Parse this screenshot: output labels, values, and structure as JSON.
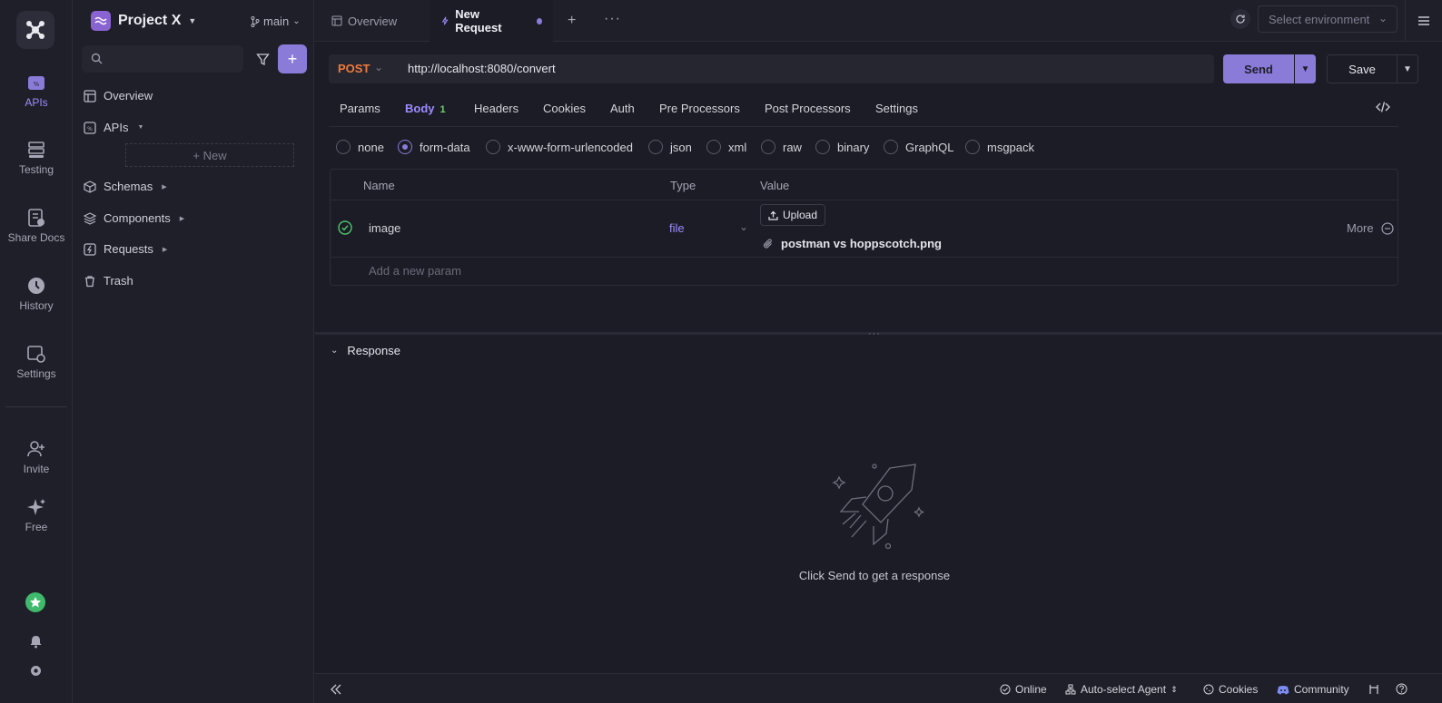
{
  "rail": {
    "items": [
      {
        "label": "APIs",
        "icon": "api-icon"
      },
      {
        "label": "Testing",
        "icon": "testing-icon"
      },
      {
        "label": "Share Docs",
        "icon": "share-docs-icon"
      },
      {
        "label": "History",
        "icon": "history-icon"
      },
      {
        "label": "Settings",
        "icon": "settings-icon"
      },
      {
        "label": "Invite",
        "icon": "invite-icon"
      },
      {
        "label": "Free",
        "icon": "sparkle-icon"
      }
    ]
  },
  "sidebar": {
    "project_name": "Project X",
    "branch": "main",
    "search_placeholder": "",
    "nav": [
      {
        "label": "Overview"
      },
      {
        "label": "APIs"
      },
      {
        "label": "Schemas"
      },
      {
        "label": "Components"
      },
      {
        "label": "Requests"
      },
      {
        "label": "Trash"
      }
    ],
    "new_label": "+ New"
  },
  "tabs": {
    "items": [
      {
        "label": "Overview"
      },
      {
        "label": "New Request"
      }
    ],
    "env_placeholder": "Select environment"
  },
  "request": {
    "method": "POST",
    "url": "http://localhost:8080/convert",
    "send_label": "Send",
    "save_label": "Save",
    "subtabs": [
      "Params",
      "Body",
      "Headers",
      "Cookies",
      "Auth",
      "Pre Processors",
      "Post Processors",
      "Settings"
    ],
    "body_count": "1",
    "body_types": [
      "none",
      "form-data",
      "x-www-form-urlencoded",
      "json",
      "xml",
      "raw",
      "binary",
      "GraphQL",
      "msgpack"
    ],
    "selected_body_type": "form-data",
    "table": {
      "headers": [
        "Name",
        "Type",
        "Value"
      ],
      "row": {
        "name": "image",
        "type": "file",
        "upload_label": "Upload",
        "file_name": "postman vs hoppscotch.png",
        "more_label": "More"
      },
      "add_placeholder": "Add a new param"
    }
  },
  "response": {
    "title": "Response",
    "empty_text": "Click Send to get a response"
  },
  "statusbar": {
    "online": "Online",
    "agent": "Auto-select Agent",
    "cookies": "Cookies",
    "community": "Community"
  },
  "colors": {
    "accent": "#8a7bd8",
    "method_post": "#f07a3a",
    "background": "#1c1c26"
  }
}
